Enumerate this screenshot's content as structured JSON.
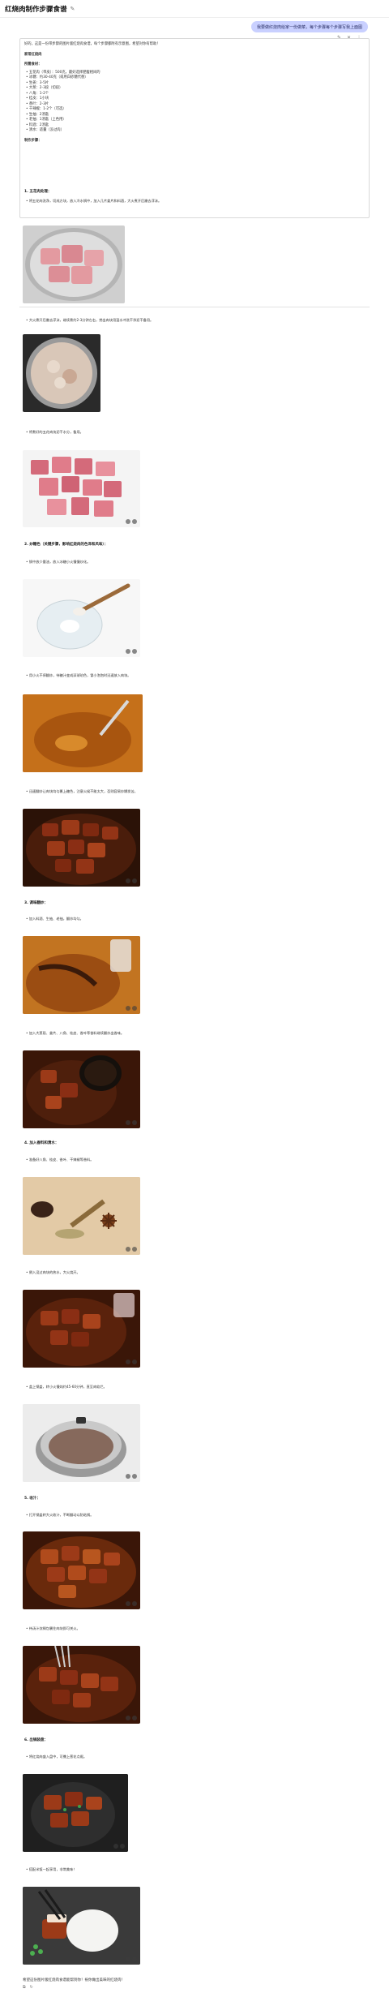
{
  "header": {
    "title": "红烧肉制作步骤食谱",
    "edit_icon": "pencil-icon"
  },
  "user_message": "我要做红烧肉给家一份做菜，每个步骤每个步骤写我上面图",
  "answer": {
    "intro": "好的，这是一份带步骤的图片版红烧肉食谱，每个步骤都附有示意图，希望对你有帮助！",
    "title": "家常红烧肉",
    "ingredients_title": "所需食材：",
    "ingredients": [
      "五花肉（带皮）：500克，最好选择肥瘦相间的",
      "冰糖：约30-40克（或用白砂糖代替）",
      "生姜：3-5片",
      "大葱：2-3段（切段）",
      "八角：1-2个",
      "桂皮：1小块",
      "香叶：2-3片",
      "干辣椒：1-2个（可选）",
      "生抽：2汤匙",
      "老抽：1汤匙（上色用）",
      "料酒：2汤匙",
      "清水：适量（没过肉）"
    ],
    "steps_title": "制作步骤："
  },
  "sections": {
    "s1": "1. 五花肉处理：",
    "s1_b1": "将五花肉洗净，切成方块，放入冷水锅中，加入几片姜片和料酒，大火煮开后撇去浮沫。",
    "s1_b2": "大火煮开后撇去浮沫，继续煮约2-3分钟左右，捞出肉块用温水冲洗干净沥干备用。",
    "s1_b3": "将煮好的五花肉块沥干水分，备用。",
    "s2": "2. 炒糖色（关键步骤，影响红烧肉的色泽和风味）：",
    "s2_b1": "锅中放少量油，放入冰糖小火慢慢炒化。",
    "s2_b2": "用小火不停翻炒，待糖汁变成深琥珀色，冒小泡泡时迅速放入肉块。",
    "s2_b3": "迅速翻炒让肉块均匀裹上糖色，注意火候不能太大，否则容易炒糊发苦。",
    "s3": "3. 调味翻炒：",
    "s3_b1": "加入料酒、生抽、老抽，翻炒均匀。",
    "s3_b2": "加入大葱段、姜片、八角、桂皮、香叶等香料继续翻炒出香味。",
    "s4": "4. 加入香料和清水：",
    "s4_b1": "准备好八角、桂皮、香叶、干辣椒等香料。",
    "s4_b2": "倒入没过肉块的热水，大火烧开。",
    "s4_b3": "盖上锅盖，转小火慢炖约45-60分钟，直至肉软烂。",
    "s5": "5. 收汁：",
    "s5_b1": "打开锅盖转大火收汁，不断翻动以防粘锅。",
    "s5_b2": "待汤汁浓稠包裹住肉块即可关火。",
    "s6": "6. 出锅装盘：",
    "s6_b1": "将红烧肉盛入盘中，可撒上葱花点缀。",
    "s6_b2": "搭配米饭一起享用，非常美味！"
  },
  "footer": {
    "text": "希望这份图片版红烧肉食谱能帮到你！祝你做出美味的红烧肉！",
    "icons": [
      "copy-icon",
      "refresh-icon"
    ]
  },
  "colors": {
    "accent": "#c9d0ff",
    "meat": "#8a2e14",
    "raw": "#e39aa0",
    "sauce": "#c5701a"
  }
}
